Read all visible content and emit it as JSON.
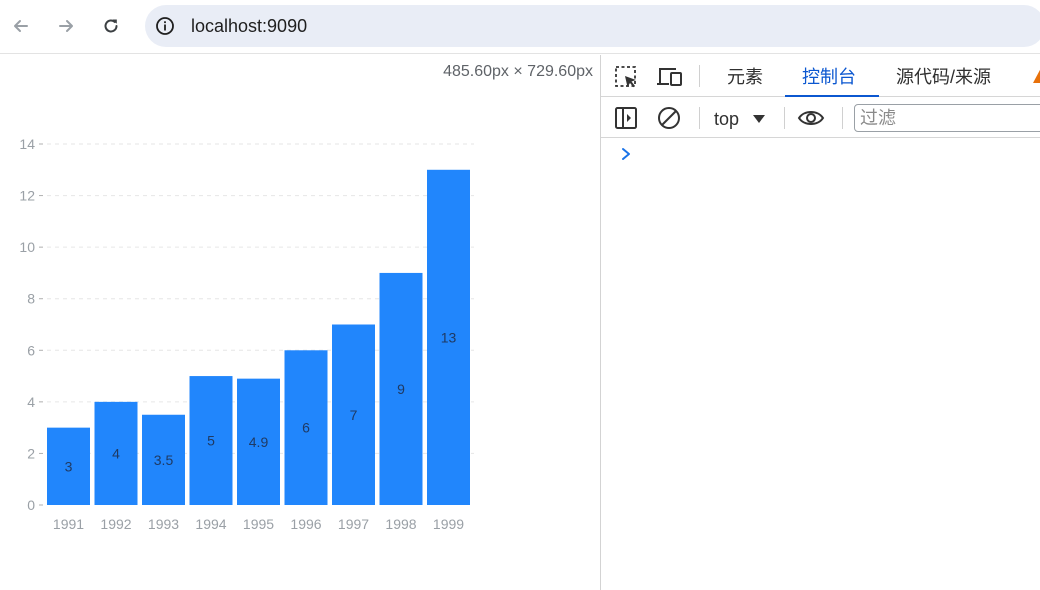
{
  "browser": {
    "url": "localhost:9090"
  },
  "viewport": {
    "dimension_label": "485.60px × 729.60px"
  },
  "devtools": {
    "tabs": [
      {
        "label": "元素",
        "active": false
      },
      {
        "label": "控制台",
        "active": true
      },
      {
        "label": "源代码/来源",
        "active": false
      }
    ],
    "context": "top",
    "filter_placeholder": "过滤"
  },
  "colors": {
    "bar": "#2186fc",
    "axis_text": "#9aa0a6",
    "label_text": "#1f3a63",
    "accent": "#0b57d0",
    "warning": "#e8710a"
  },
  "chart_data": {
    "type": "bar",
    "categories": [
      "1991",
      "1992",
      "1993",
      "1994",
      "1995",
      "1996",
      "1997",
      "1998",
      "1999"
    ],
    "values": [
      3,
      4,
      3.5,
      5,
      4.9,
      6,
      7,
      9,
      13
    ],
    "title": "",
    "xlabel": "",
    "ylabel": "",
    "ylim": [
      0,
      14
    ],
    "yticks": [
      0,
      2,
      4,
      6,
      8,
      10,
      12,
      14
    ],
    "grid": true,
    "data_labels": true
  }
}
